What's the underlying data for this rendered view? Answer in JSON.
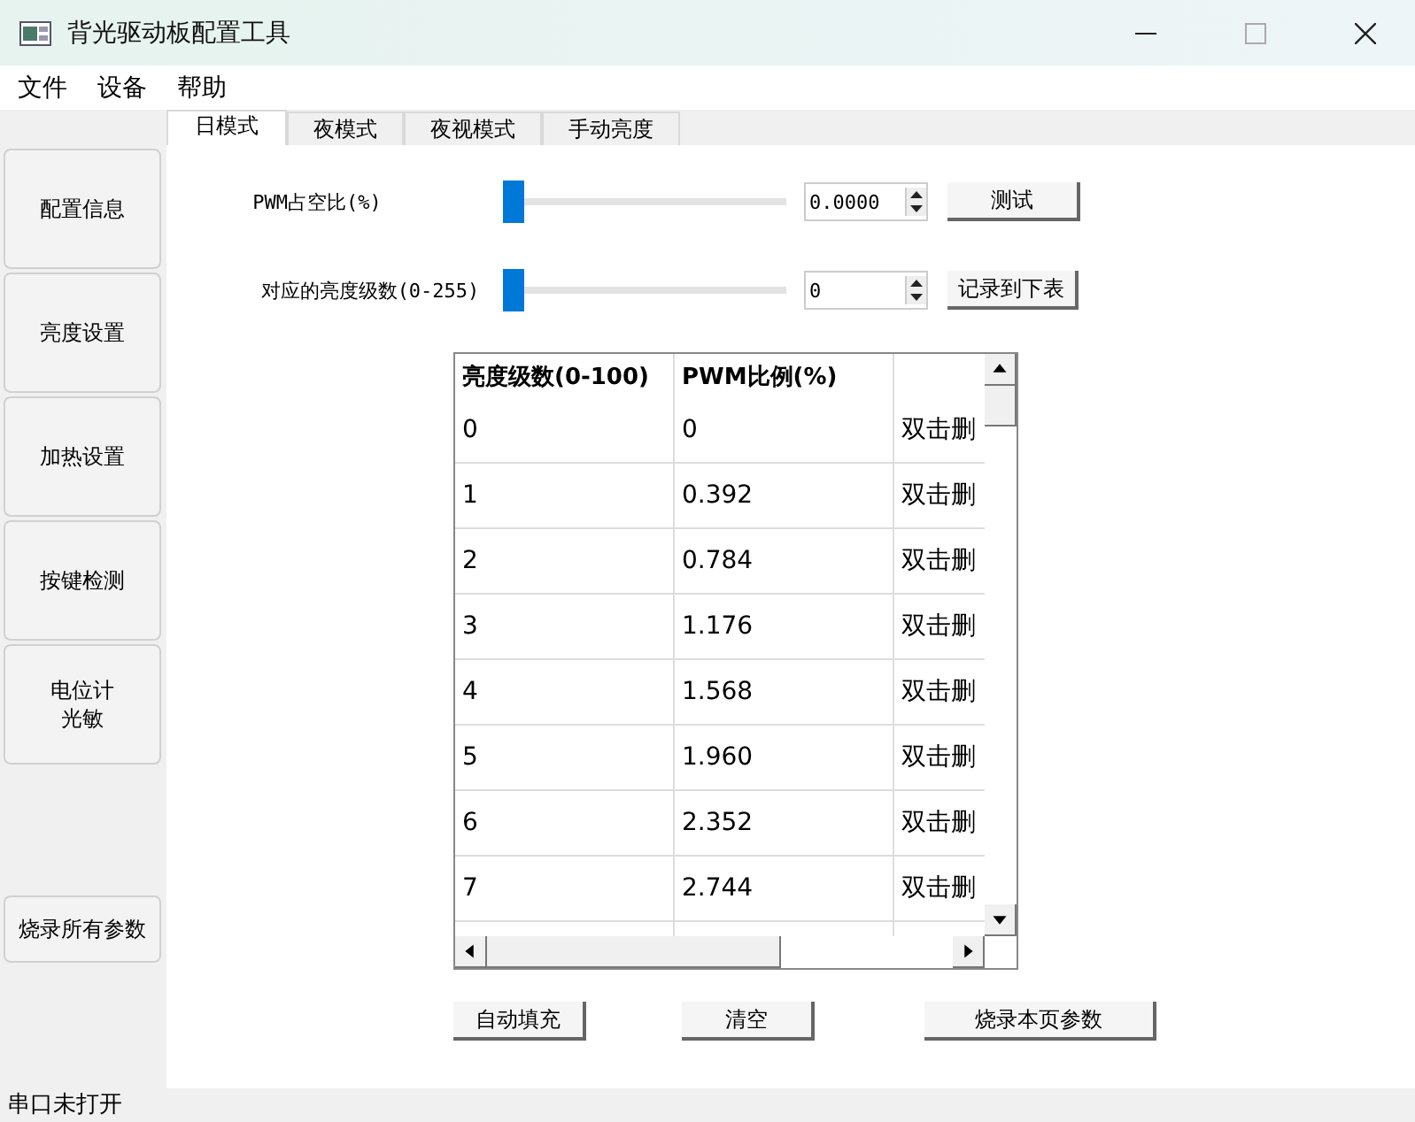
{
  "window": {
    "title": "背光驱动板配置工具"
  },
  "menu": [
    "文件",
    "设备",
    "帮助"
  ],
  "sidebar": {
    "items": [
      {
        "lines": [
          "配置信息"
        ]
      },
      {
        "lines": [
          "亮度设置"
        ]
      },
      {
        "lines": [
          "加热设置"
        ]
      },
      {
        "lines": [
          "按键检测"
        ]
      },
      {
        "lines": [
          "电位计",
          "光敏"
        ]
      }
    ],
    "burn_button": "烧录所有参数"
  },
  "tabs": [
    {
      "label": "日模式",
      "selected": true
    },
    {
      "label": "夜模式",
      "selected": false
    },
    {
      "label": "夜视模式",
      "selected": false
    },
    {
      "label": "手动亮度",
      "selected": false
    }
  ],
  "controls": [
    {
      "label": "PWM占空比(%)",
      "level": 0,
      "value": "0.0000",
      "button": "测试"
    },
    {
      "label": "对应的亮度级数(0-255)",
      "level": 0,
      "value": "0",
      "button": "记录到下表"
    }
  ],
  "table": {
    "columns": [
      "亮度级数(0-100)",
      "PWM比例(%)"
    ],
    "rows": [
      [
        "0",
        "0",
        "双击删"
      ],
      [
        "1",
        "0.392",
        "双击删"
      ],
      [
        "2",
        "0.784",
        "双击删"
      ],
      [
        "3",
        "1.176",
        "双击删"
      ],
      [
        "4",
        "1.568",
        "双击删"
      ],
      [
        "5",
        "1.960",
        "双击删"
      ],
      [
        "6",
        "2.352",
        "双击删"
      ],
      [
        "7",
        "2.744",
        "双击删"
      ]
    ]
  },
  "buttons": [
    "自动填充",
    "清空",
    "烧录本页参数"
  ],
  "status_bar": "串口未打开"
}
